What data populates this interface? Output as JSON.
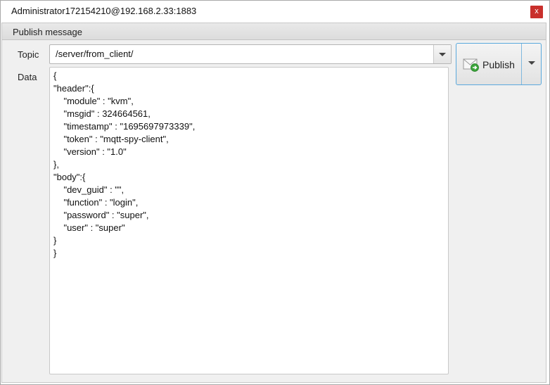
{
  "window": {
    "title": "Administrator172154210@192.168.2.33:1883",
    "close_label": "x"
  },
  "pane": {
    "title": "Publish message"
  },
  "form": {
    "topic_label": "Topic",
    "topic_value": "/server/from_client/",
    "data_label": "Data",
    "data_value": "{\n\"header\":{\n\t\"module\" : \"kvm\",\n\t\"msgid\" : 324664561,\n\t\"timestamp\" : \"1695697973339\",\n\t\"token\" : \"mqtt-spy-client\",\n\t\"version\" : \"1.0\"\n},\n\"body\":{\n\t\"dev_guid\" : \"\",\n\t\"function\" : \"login\",\n\t\"password\" : \"super\",\n\t\"user\" : \"super\"\n}\n}"
  },
  "publish": {
    "label": "Publish",
    "icon": "envelope-send-icon",
    "accent": "#5aa9dd"
  },
  "colors": {
    "close_button": "#c9302c",
    "pane_background": "#f0f0f0"
  }
}
